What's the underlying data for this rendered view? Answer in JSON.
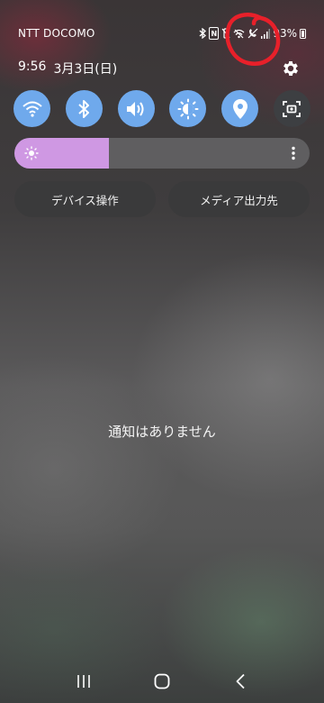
{
  "status_bar": {
    "carrier": "NTT DOCOMO",
    "battery_percent": "93%",
    "nfc_label": "N",
    "icons": [
      "bluetooth-icon",
      "nfc-icon",
      "vibrate-mute-icon",
      "wifi-off-icon",
      "call-off-icon",
      "signal-icon",
      "battery-icon"
    ]
  },
  "header": {
    "time": "9:56",
    "date": "3月3日(日)"
  },
  "quick_settings": {
    "toggles": [
      {
        "name": "wifi",
        "icon": "wifi-icon",
        "on": true
      },
      {
        "name": "bluetooth",
        "icon": "bluetooth-icon",
        "on": true
      },
      {
        "name": "sound",
        "icon": "sound-icon",
        "on": true
      },
      {
        "name": "auto-rotate",
        "icon": "rotate-icon",
        "on": true
      },
      {
        "name": "location",
        "icon": "location-icon",
        "on": true
      },
      {
        "name": "screen-capture",
        "icon": "screen-capture-icon",
        "on": false
      }
    ],
    "accent_color": "#6fa9ec"
  },
  "brightness": {
    "level": 0.32,
    "fill_color": "#cf98e3"
  },
  "buttons": {
    "device_control": "デバイス操作",
    "media_output": "メディア出力先"
  },
  "notifications": {
    "empty_message": "通知はありません"
  },
  "annotation": {
    "color": "#e8202a"
  }
}
